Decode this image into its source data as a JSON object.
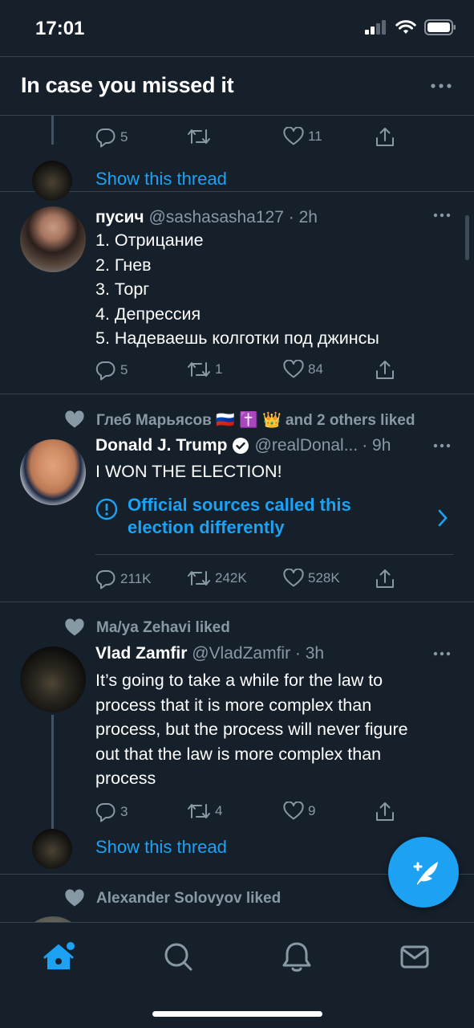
{
  "status_bar": {
    "time": "17:01"
  },
  "header": {
    "title": "In case you missed it"
  },
  "tweets": [
    {
      "actions": {
        "replies": "5",
        "retweets": "",
        "likes": "11"
      },
      "show_thread": "Show this thread"
    },
    {
      "name": "пусич",
      "handle": "@sashasasha127",
      "time": "· 2h",
      "lines": [
        "1. Отрицание",
        "2. Гнев",
        "3. Торг",
        "4. Депрессия",
        "5. Надеваешь колготки под джинсы"
      ],
      "actions": {
        "replies": "5",
        "retweets": "1",
        "likes": "84"
      }
    },
    {
      "social_context": "Глеб Марьясов 🇷🇺 ✝️ 👑 and 2 others liked",
      "name": "Donald J. Trump",
      "verified": true,
      "handle": "@realDonal...",
      "time": "· 9h",
      "text": "I WON THE ELECTION!",
      "notice": "Official sources called this election differently",
      "actions": {
        "replies": "211K",
        "retweets": "242K",
        "likes": "528K"
      }
    },
    {
      "social_context": "Ma/ya Zehavi liked",
      "name": "Vlad Zamfir",
      "handle": "@VladZamfir",
      "time": "· 3h",
      "lines": [
        "It’s going to take a while for the law to",
        "process that it is more complex than",
        "process, but the process will never figure",
        "out that the law is more complex than",
        "process"
      ],
      "actions": {
        "replies": "3",
        "retweets": "4",
        "likes": "9"
      },
      "show_thread": "Show this thread"
    },
    {
      "social_context": "Alexander Solovyov liked"
    }
  ],
  "colors": {
    "background": "#15202b",
    "accent": "#1da1f2",
    "secondary_text": "#8899a6",
    "divider": "#38444d"
  },
  "tabs": [
    "home-icon",
    "search-icon",
    "notifications-icon",
    "messages-icon"
  ]
}
